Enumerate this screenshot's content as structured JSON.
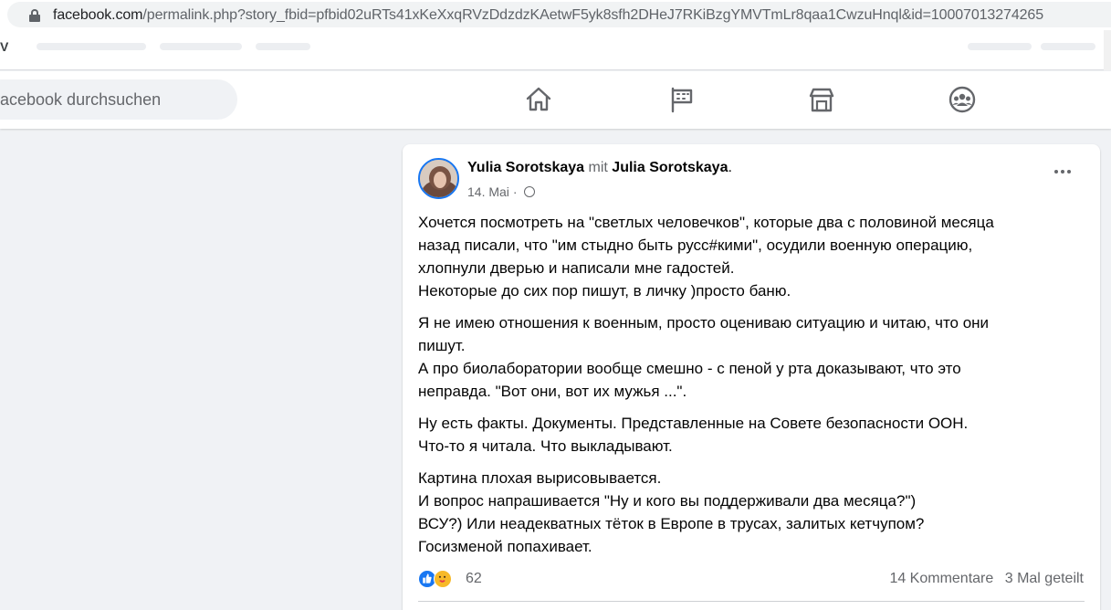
{
  "browser": {
    "url_host": "facebook.com",
    "url_path": "/permalink.php?story_fbid=pfbid02uRTs41xKeXxqRVzDdzdzKAetwF5yk8sfh2DHeJ7RKiBzgYMVTmLr8qaa1CwzuHnql&id=10007013274265"
  },
  "bookmarks": {
    "fragment": "V"
  },
  "header": {
    "search_placeholder": "acebook durchsuchen",
    "nav": [
      {
        "icon": "home-icon"
      },
      {
        "icon": "pages-flag-icon"
      },
      {
        "icon": "marketplace-icon"
      },
      {
        "icon": "groups-icon"
      }
    ]
  },
  "post": {
    "author": "Yulia Sorotskaya",
    "with_word": "mit",
    "tagged": "Julia Sorotskaya",
    "after_tagged": ".",
    "date": "14. Mai",
    "separator": "·",
    "audience_icon": "globe-icon",
    "paragraphs": [
      [
        "Хочется посмотреть на \"светлых человечков\", которые два с половиной месяца",
        "назад писали, что \"им стыдно быть русс#кими\", осудили военную операцию,",
        "хлопнули дверью и написали мне гадостей.",
        "Некоторые до сих пор пишут, в личку )просто баню."
      ],
      [
        "Я не имею отношения к военным, просто оцениваю ситуацию и читаю, что они",
        "пишут.",
        "А про биолаборатории вообще смешно - с пеной у рта доказывают, что это",
        "неправда. \"Вот они, вот их мужья ...\"."
      ],
      [
        "Ну есть факты. Документы. Представленные на Совете безопасности ООН.",
        "Что-то я читала. Что выкладывают."
      ],
      [
        "Картина плохая вырисовывается.",
        "И вопрос напрашивается \"Ну и кого вы поддерживали два месяца?\")",
        "ВСУ?) Или неадекватных тёток в Европе в трусах, залитых кетчупом?",
        "Госизменой попахивает."
      ]
    ],
    "reaction_count": "62",
    "comments": "14 Kommentare",
    "shares": "3 Mal geteilt"
  },
  "colors": {
    "accent": "#1877f2",
    "secondary_text": "#65676b",
    "page_bg": "#f0f2f5"
  }
}
